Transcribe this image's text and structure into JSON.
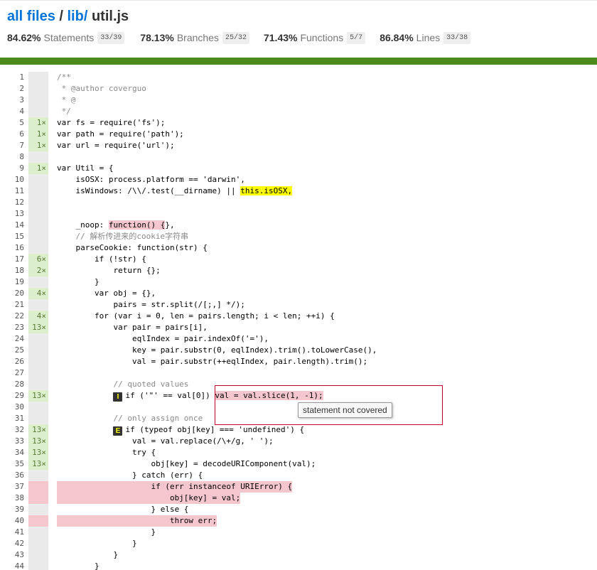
{
  "header": {
    "crumbs": {
      "all_files": "all files",
      "sep": "/",
      "lib": "lib/",
      "file": "util.js"
    },
    "stats": [
      {
        "pct": "84.62%",
        "label": "Statements",
        "frac": "33/39"
      },
      {
        "pct": "78.13%",
        "label": "Branches",
        "frac": "25/32"
      },
      {
        "pct": "71.43%",
        "label": "Functions",
        "frac": "5/7"
      },
      {
        "pct": "86.84%",
        "label": "Lines",
        "frac": "33/38"
      }
    ]
  },
  "colors": {
    "link": "#0074d9",
    "coverage_high": "#4d8a1c",
    "uncovered": "#f6c6ce",
    "covered_count": "#dcefcc",
    "branch_marker": "#ffff00"
  },
  "tooltip": {
    "text": "statement not covered"
  },
  "branch_badges": {
    "if_path": "I",
    "else_path": "E"
  },
  "lines": [
    {
      "n": "1",
      "c": "",
      "s": "/**"
    },
    {
      "n": "2",
      "c": "",
      "s": " * @author coverguo"
    },
    {
      "n": "3",
      "c": "",
      "s": " * @"
    },
    {
      "n": "4",
      "c": "",
      "s": " */"
    },
    {
      "n": "5",
      "c": "1×",
      "s": "var fs = require('fs');"
    },
    {
      "n": "6",
      "c": "1×",
      "s": "var path = require('path');"
    },
    {
      "n": "7",
      "c": "1×",
      "s": "var url = require('url');"
    },
    {
      "n": "8",
      "c": "",
      "s": ""
    },
    {
      "n": "9",
      "c": "1×",
      "s": "var Util = {"
    },
    {
      "n": "10",
      "c": "",
      "s": "    isOSX: process.platform == 'darwin',"
    },
    {
      "n": "11",
      "c": "",
      "s": "    isWindows: /\\\\/.test(__dirname) || ",
      "s2": "this.isOSX,",
      "mk2": "yel"
    },
    {
      "n": "12",
      "c": "",
      "s": ""
    },
    {
      "n": "13",
      "c": "",
      "s": ""
    },
    {
      "n": "14",
      "c": "",
      "s": "    _noop: ",
      "s2": "function() {",
      "mk2": "red",
      "s3": "},"
    },
    {
      "n": "15",
      "c": "",
      "s": "    // 解析传进来的cookie字符串"
    },
    {
      "n": "16",
      "c": "",
      "s": "    parseCookie: function(str) {"
    },
    {
      "n": "17",
      "c": "6×",
      "s": "        if (!str) {"
    },
    {
      "n": "18",
      "c": "2×",
      "s": "            return {};"
    },
    {
      "n": "19",
      "c": "",
      "s": "        }"
    },
    {
      "n": "20",
      "c": "4×",
      "s": "        var obj = {},"
    },
    {
      "n": "21",
      "c": "",
      "s": "            pairs = str.split(/[;,] */);"
    },
    {
      "n": "22",
      "c": "4×",
      "s": "        for (var i = 0, len = pairs.length; i < len; ++i) {"
    },
    {
      "n": "23",
      "c": "13×",
      "s": "            var pair = pairs[i],"
    },
    {
      "n": "24",
      "c": "",
      "s": "                eqlIndex = pair.indexOf('='),"
    },
    {
      "n": "25",
      "c": "",
      "s": "                key = pair.substr(0, eqlIndex).trim().toLowerCase(),"
    },
    {
      "n": "26",
      "c": "",
      "s": "                val = pair.substr(++eqlIndex, pair.length).trim();"
    },
    {
      "n": "27",
      "c": "",
      "s": ""
    },
    {
      "n": "28",
      "c": "",
      "s": "            // quoted values"
    },
    {
      "n": "29",
      "c": "13×",
      "s": "            ",
      "badge": "I",
      "s2": "if ('\"' == val[0]) ",
      "s3": "val = val.slice(1, -1);",
      "mk3": "red"
    },
    {
      "n": "30",
      "c": "",
      "s": ""
    },
    {
      "n": "31",
      "c": "",
      "s": "            // only assign once"
    },
    {
      "n": "32",
      "c": "13×",
      "s": "            ",
      "badge": "E",
      "s2": "if (typeof obj[key] === 'undefined') {"
    },
    {
      "n": "33",
      "c": "13×",
      "s": "                val = val.replace(/\\+/g, ' ');"
    },
    {
      "n": "34",
      "c": "13×",
      "s": "                try {"
    },
    {
      "n": "35",
      "c": "13×",
      "s": "                    obj[key] = decodeURIComponent(val);"
    },
    {
      "n": "36",
      "c": "",
      "s": "                } catch (err) {"
    },
    {
      "n": "37",
      "c": "",
      "s": "                    if (err instanceof URIError) {",
      "uncovered": true
    },
    {
      "n": "38",
      "c": "",
      "s": "                        obj[key] = val;",
      "uncovered": true
    },
    {
      "n": "39",
      "c": "",
      "s": "                    } else {"
    },
    {
      "n": "40",
      "c": "",
      "s": "                        throw err;",
      "uncovered": true
    },
    {
      "n": "41",
      "c": "",
      "s": "                    }"
    },
    {
      "n": "42",
      "c": "",
      "s": "                }"
    },
    {
      "n": "43",
      "c": "",
      "s": "            }"
    },
    {
      "n": "44",
      "c": "",
      "s": "        }"
    }
  ]
}
